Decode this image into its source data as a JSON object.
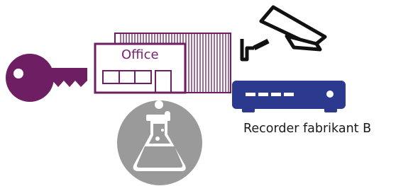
{
  "colors": {
    "purple": "#6e1f63",
    "navy": "#2b3a8f",
    "gray": "#9a9a9a",
    "black": "#111111",
    "white": "#ffffff"
  },
  "icons": {
    "key": "key-icon",
    "office": "office-building-icon",
    "camera": "security-camera-icon",
    "recorder": "video-recorder-icon",
    "lab": "lab-flask-icon"
  },
  "office": {
    "label": "Office"
  },
  "recorder": {
    "caption": "Recorder fabrikant B"
  }
}
